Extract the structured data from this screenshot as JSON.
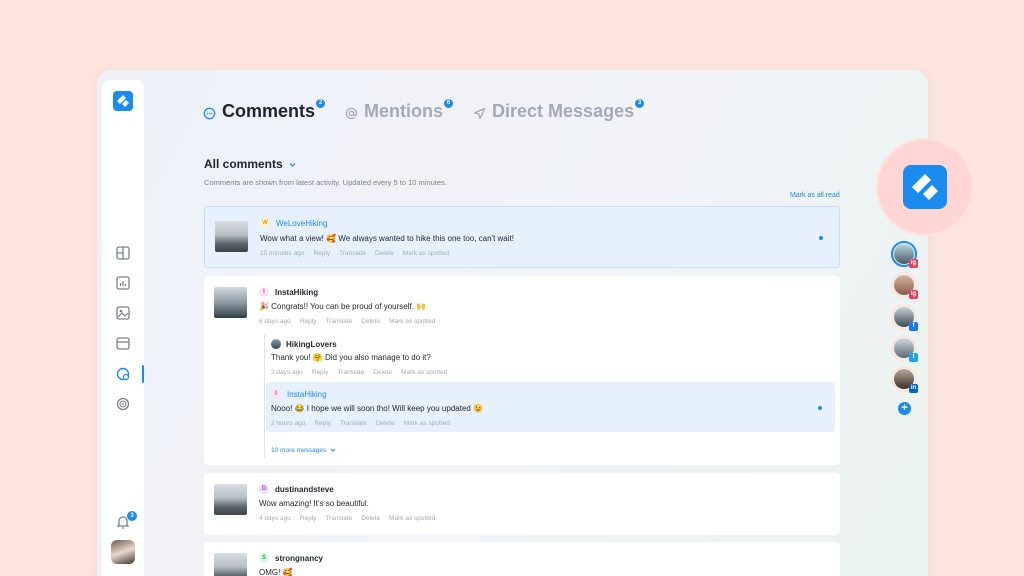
{
  "tabs": [
    {
      "label": "Comments",
      "badge": "2",
      "icon": "comment-icon",
      "active": true
    },
    {
      "label": "Mentions",
      "badge": "6",
      "icon": "at-icon",
      "active": false
    },
    {
      "label": "Direct Messages",
      "badge": "3",
      "icon": "send-icon",
      "active": false
    }
  ],
  "filter": {
    "label": "All comments"
  },
  "info": "Comments are shown from latest activity. Updated every 5 to 10 minutes.",
  "mark_all": "Mark as all read",
  "sidebar": {
    "notification_badge": "3"
  },
  "actions": {
    "reply": "Reply",
    "translate": "Translate",
    "delete": "Delete",
    "spotted": "Mark as spotted"
  },
  "comments": [
    {
      "initial": "W",
      "author": "WeLoveHiking",
      "text": "Wow what a view! 🥰 We always wanted to hike this one too, can't wait!",
      "time": "15 minutes ago"
    },
    {
      "initial": "I",
      "author": "InstaHiking",
      "text": "🎉 Congrats!! You can be proud of yourself. 🙌",
      "time": "6 days ago",
      "replies": [
        {
          "author": "HikingLovers",
          "text": "Thank you! 🤗 Did you also manage to do it?",
          "time": "2 days ago"
        },
        {
          "initial": "I",
          "author": "InstaHiking",
          "text": "Nooo! 😂 I hope we will soon tho! Will keep you updated 😉",
          "time": "2 hours ago"
        }
      ],
      "more": "10 more messages"
    },
    {
      "initial": "D",
      "author": "dustinandsteve",
      "text": "Wow amazing! It's so beautiful.",
      "time": "4 days ago"
    },
    {
      "initial": "S",
      "author": "strongnancy",
      "text": "OMG! 🥰"
    }
  ],
  "accounts": [
    {
      "badge": "ig",
      "color": "#e4405f"
    },
    {
      "badge": "ig",
      "color": "#e4405f"
    },
    {
      "badge": "f",
      "color": "#1877f2"
    },
    {
      "badge": "t",
      "color": "#1da1f2"
    },
    {
      "badge": "in",
      "color": "#0a66c2"
    }
  ],
  "colors": {
    "accent": "#1a8cf0",
    "background": "#fde4df"
  }
}
